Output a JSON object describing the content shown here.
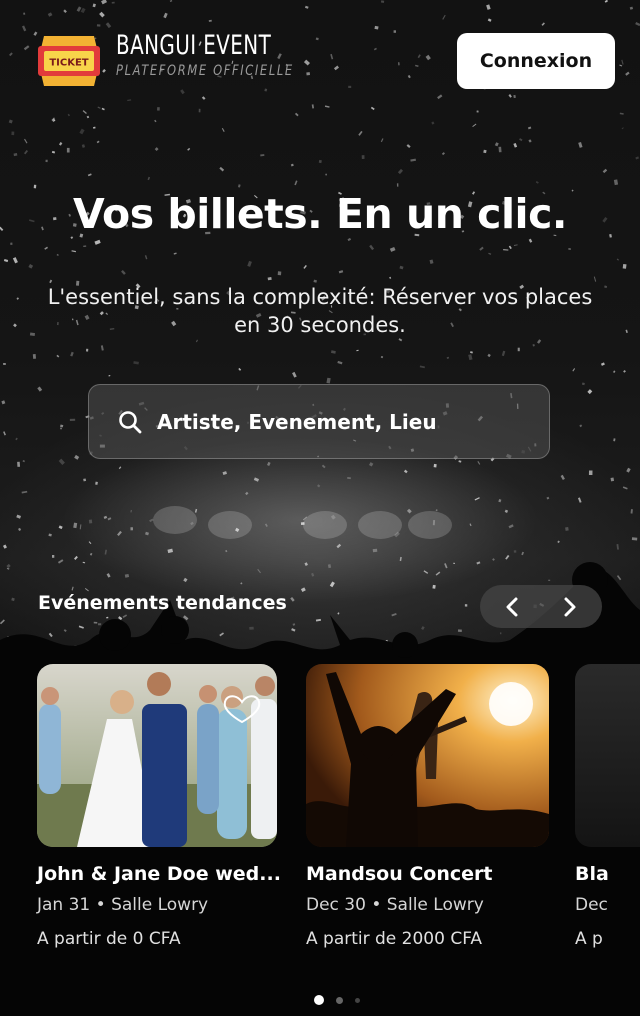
{
  "header": {
    "logo_text": "TICKET",
    "brand_name": "BANGUI EVENT",
    "brand_tagline": "PLATEFORME OFFICIELLE",
    "login_label": "Connexion"
  },
  "hero": {
    "title": "Vos billets. En un clic.",
    "subtitle": "L'essentiel, sans la complexité: Réserver vos places en 30 secondes."
  },
  "search": {
    "placeholder": "Artiste, Evenement, Lieu"
  },
  "trending": {
    "title": "Evénements tendances",
    "events": [
      {
        "title": "John & Jane Doe wed...",
        "meta": "Jan 31 • Salle Lowry",
        "price": "A partir de 0 CFA"
      },
      {
        "title": "Mandsou Concert",
        "meta": "Dec 30 • Salle Lowry",
        "price": "A partir de 2000 CFA"
      },
      {
        "title": "Bla",
        "meta": "Dec",
        "price": "A p"
      }
    ]
  },
  "pagination": {
    "pages": 3,
    "current": 1
  }
}
